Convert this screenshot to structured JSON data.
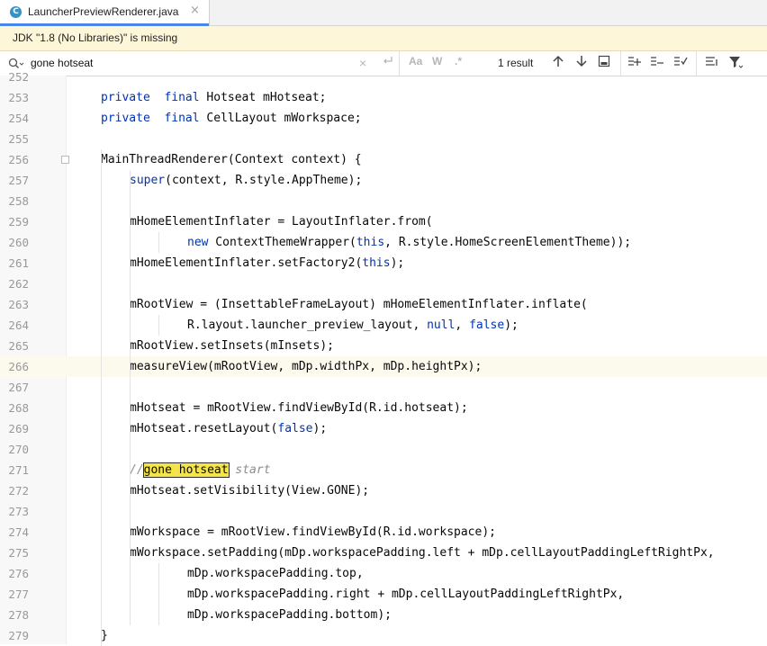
{
  "tab": {
    "icon_letter": "C",
    "title": "LauncherPreviewRenderer.java",
    "close": "×"
  },
  "banner": {
    "text": "JDK \"1.8 (No Libraries)\" is missing"
  },
  "search": {
    "query": "gone hotseat",
    "clear": "×",
    "match_case": "Aa",
    "words": "W",
    "regex": ".*",
    "result_count": "1 result"
  },
  "lines": [
    {
      "n": "252",
      "indent": 0,
      "tokens": []
    },
    {
      "n": "253",
      "indent": 1,
      "tokens": [
        [
          "kw",
          "private"
        ],
        [
          "",
          "  "
        ],
        [
          "kw",
          "final"
        ],
        [
          "",
          " Hotseat mHotseat;"
        ]
      ]
    },
    {
      "n": "254",
      "indent": 1,
      "tokens": [
        [
          "kw",
          "private"
        ],
        [
          "",
          "  "
        ],
        [
          "kw",
          "final"
        ],
        [
          "",
          " CellLayout mWorkspace;"
        ]
      ]
    },
    {
      "n": "255",
      "indent": 0,
      "tokens": []
    },
    {
      "n": "256",
      "indent": 1,
      "tokens": [
        [
          "",
          "MainThreadRenderer(Context context) {"
        ]
      ],
      "fold": true
    },
    {
      "n": "257",
      "indent": 2,
      "tokens": [
        [
          "kw",
          "super"
        ],
        [
          "",
          "(context, R.style.AppTheme);"
        ]
      ]
    },
    {
      "n": "258",
      "indent": 0,
      "tokens": []
    },
    {
      "n": "259",
      "indent": 2,
      "tokens": [
        [
          "",
          "mHomeElementInflater = LayoutInflater.from("
        ]
      ]
    },
    {
      "n": "260",
      "indent": 4,
      "tokens": [
        [
          "kw",
          "new"
        ],
        [
          "",
          " ContextThemeWrapper("
        ],
        [
          "kw",
          "this"
        ],
        [
          "",
          ", R.style.HomeScreenElementTheme));"
        ]
      ]
    },
    {
      "n": "261",
      "indent": 2,
      "tokens": [
        [
          "",
          "mHomeElementInflater.setFactory2("
        ],
        [
          "kw",
          "this"
        ],
        [
          "",
          ");"
        ]
      ]
    },
    {
      "n": "262",
      "indent": 0,
      "tokens": []
    },
    {
      "n": "263",
      "indent": 2,
      "tokens": [
        [
          "",
          "mRootView = (InsettableFrameLayout) mHomeElementInflater.inflate("
        ]
      ]
    },
    {
      "n": "264",
      "indent": 4,
      "tokens": [
        [
          "",
          "R.layout.launcher_preview_layout, "
        ],
        [
          "kw",
          "null"
        ],
        [
          "",
          ", "
        ],
        [
          "kw",
          "false"
        ],
        [
          "",
          ");"
        ]
      ]
    },
    {
      "n": "265",
      "indent": 2,
      "tokens": [
        [
          "",
          "mRootView.setInsets(mInsets);"
        ]
      ]
    },
    {
      "n": "266",
      "indent": 2,
      "tokens": [
        [
          "",
          "measureView(mRootView, mDp.widthPx, mDp.heightPx);"
        ]
      ],
      "current": true
    },
    {
      "n": "267",
      "indent": 0,
      "tokens": []
    },
    {
      "n": "268",
      "indent": 2,
      "tokens": [
        [
          "",
          "mHotseat = mRootView.findViewById(R.id.hotseat);"
        ]
      ]
    },
    {
      "n": "269",
      "indent": 2,
      "tokens": [
        [
          "",
          "mHotseat.resetLayout("
        ],
        [
          "kw",
          "false"
        ],
        [
          "",
          ");"
        ]
      ]
    },
    {
      "n": "270",
      "indent": 0,
      "tokens": []
    },
    {
      "n": "271",
      "indent": 2,
      "tokens": [
        [
          "cm",
          "//"
        ],
        [
          "hl",
          "gone hotseat"
        ],
        [
          "cm",
          " start"
        ]
      ]
    },
    {
      "n": "272",
      "indent": 2,
      "tokens": [
        [
          "",
          "mHotseat.setVisibility(View.GONE);"
        ]
      ]
    },
    {
      "n": "273",
      "indent": 0,
      "tokens": []
    },
    {
      "n": "274",
      "indent": 2,
      "tokens": [
        [
          "",
          "mWorkspace = mRootView.findViewById(R.id.workspace);"
        ]
      ]
    },
    {
      "n": "275",
      "indent": 2,
      "tokens": [
        [
          "",
          "mWorkspace.setPadding(mDp.workspacePadding.left + mDp.cellLayoutPaddingLeftRightPx,"
        ]
      ]
    },
    {
      "n": "276",
      "indent": 4,
      "tokens": [
        [
          "",
          "mDp.workspacePadding.top,"
        ]
      ]
    },
    {
      "n": "277",
      "indent": 4,
      "tokens": [
        [
          "",
          "mDp.workspacePadding.right + mDp.cellLayoutPaddingLeftRightPx,"
        ]
      ]
    },
    {
      "n": "278",
      "indent": 4,
      "tokens": [
        [
          "",
          "mDp.workspacePadding.bottom);"
        ]
      ]
    },
    {
      "n": "279",
      "indent": 1,
      "tokens": [
        [
          "",
          "}"
        ]
      ]
    }
  ]
}
